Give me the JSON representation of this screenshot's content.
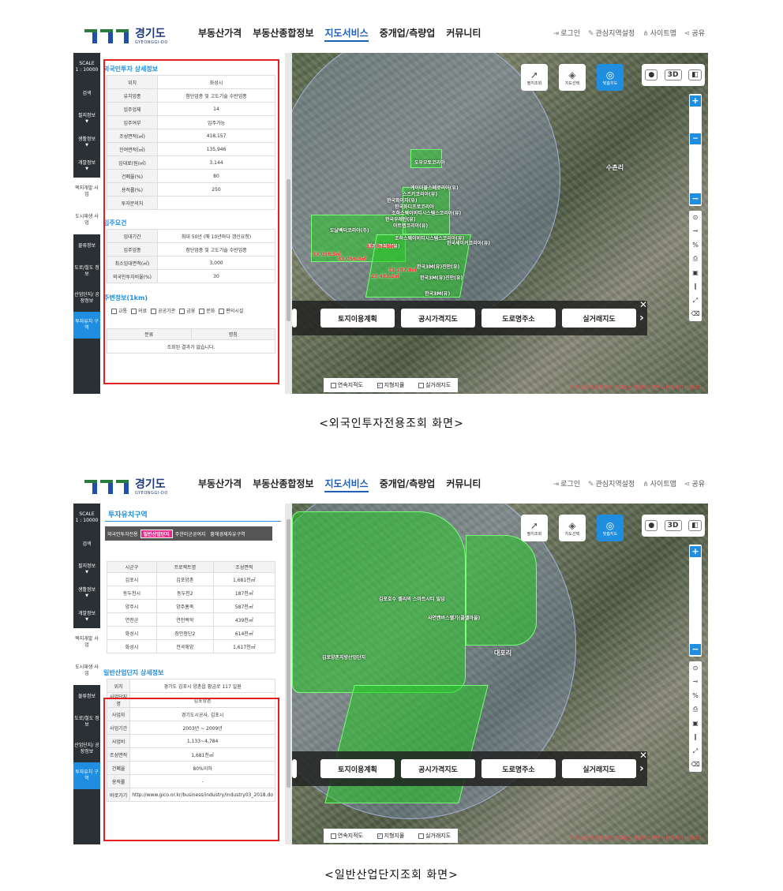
{
  "header": {
    "logo_ko": "경기도",
    "logo_en": "GYEONGGI-DO",
    "nav": [
      "부동산가격",
      "부동산종합정보",
      "지도서비스",
      "중개업/측량업",
      "커뮤니티"
    ],
    "util": [
      "로그인",
      "관심지역설정",
      "사이트맵",
      "공유"
    ]
  },
  "sidebar": {
    "scale_label": "SCALE",
    "scale_value": "1 : 10000",
    "items": [
      "검색",
      "필지정보",
      "생활정보",
      "개발정보",
      "택지개발 사업",
      "도시재생 사업",
      "물류정보",
      "도로/철도 정보",
      "산업단지/ 공장정보",
      "투자유치 구역"
    ]
  },
  "map": {
    "buttons": [
      "필지조회",
      "지도선택",
      "맞춤지도"
    ],
    "view_3d": "3D",
    "layers": [
      "토지이용계획",
      "공시가격지도",
      "도로명주소",
      "실거래지도"
    ],
    "checks": [
      "연속지적도",
      "지형지물",
      "실거래지도"
    ],
    "warning": "지적도를 포함한 모든 주제도는 참고용으로만 사용하시기 바랍니다.",
    "labels1": [
      "도우모토코리아",
      "케이더블스페로리아(유)",
      "스즈키코리아(유)",
      "한국화이자(유)",
      "한국화디프로코리아",
      "조하스웨이비티시스템스코리아(유)",
      "한국우레탄(유)",
      "아트랩코리아(유)",
      "도날벡터코리아(주)",
      "조하스웨이비티시스템스코리아(유)",
      "한국세이커코리아(유)",
      "화거 코리아(유)",
      "한국3M(유)진안(유)",
      "한국3M(유)진안(유)",
      "한국3M(유)"
    ],
    "redlabels1": [
      "33,056.5㎡",
      "33,056.3㎡",
      "33,062.8㎡",
      "13,287.8㎡",
      "23,483.2㎡"
    ],
    "place1": "수촌리",
    "labels2": [
      "김포호수 밸리의 스마트시티 빌딩",
      "사연캔버스밸기(콜밸마을)",
      "김포양촌지방산업단지"
    ],
    "place2": "대포리"
  },
  "shot1": {
    "detail_title": "외국인투자 상세정보",
    "detail": [
      [
        "위치",
        "화성시"
      ],
      [
        "유치업종",
        "첨단업종 및 고도기술 수반업종"
      ],
      [
        "입주업체",
        "14"
      ],
      [
        "입주여부",
        "입주가능"
      ],
      [
        "조성면적(㎡)",
        "418,157"
      ],
      [
        "잔여면적(㎡)",
        "135,946"
      ],
      [
        "임대료(원/㎡)",
        "3,144"
      ],
      [
        "건폐율(%)",
        "80"
      ],
      [
        "용적률(%)",
        "250"
      ],
      [
        "투자문의처",
        ""
      ]
    ],
    "req_title": "입주요건",
    "req": [
      [
        "임대기간",
        "최대 50년 (매 10년마다 갱신요청)"
      ],
      [
        "입주업종",
        "첨단업종 및 고도기술 수반업종"
      ],
      [
        "최소임대면적(㎡)",
        "3,000"
      ],
      [
        "외국인투자비율(%)",
        "30"
      ]
    ],
    "near_title": "주변정보(1km)",
    "near": [
      "교통",
      "의료",
      "공공기관",
      "금융",
      "문화",
      "편의시설"
    ],
    "near_head": [
      "분류",
      "명칭"
    ],
    "near_empty": "조회된 결과가 없습니다.",
    "caption": "<외국인투자전용조회 화면>"
  },
  "shot2": {
    "panel_title": "투자유치구역",
    "tabs": [
      "외국인투자전용",
      "일반산업단지",
      "주한미군공여지",
      "황해경제자유구역"
    ],
    "list_head": [
      "시군구",
      "프로젝트명",
      "조성면적"
    ],
    "list": [
      [
        "김포시",
        "김포양촌",
        "1,681천㎡"
      ],
      [
        "동두천시",
        "동두천2",
        "187천㎡"
      ],
      [
        "양주시",
        "양주홍죽",
        "587천㎡"
      ],
      [
        "연천군",
        "연천백학",
        "439천㎡"
      ],
      [
        "화성시",
        "장안첨단2",
        "614천㎡"
      ],
      [
        "화성시",
        "전곡해양",
        "1,617천㎡"
      ]
    ],
    "detail_title": "일반산업단지 상세정보",
    "detail": [
      [
        "위치",
        "경기도 김포시 양촌읍 황금로 117 일원"
      ],
      [
        "사업단지명",
        "김포양촌"
      ],
      [
        "사업자",
        "경기도시공사, 김포시"
      ],
      [
        "사업기간",
        "2003년 ~ 2009년"
      ],
      [
        "사업비",
        "1,133~4,784"
      ],
      [
        "조성면적",
        "1,681천㎡"
      ],
      [
        "건폐율",
        "80%이하"
      ],
      [
        "용적률",
        "-"
      ],
      [
        "바로가기",
        "http://www.gico.or.kr/business/industry/industry03_2018.do"
      ]
    ],
    "caption": "<일반산업단지조회 화면>"
  }
}
